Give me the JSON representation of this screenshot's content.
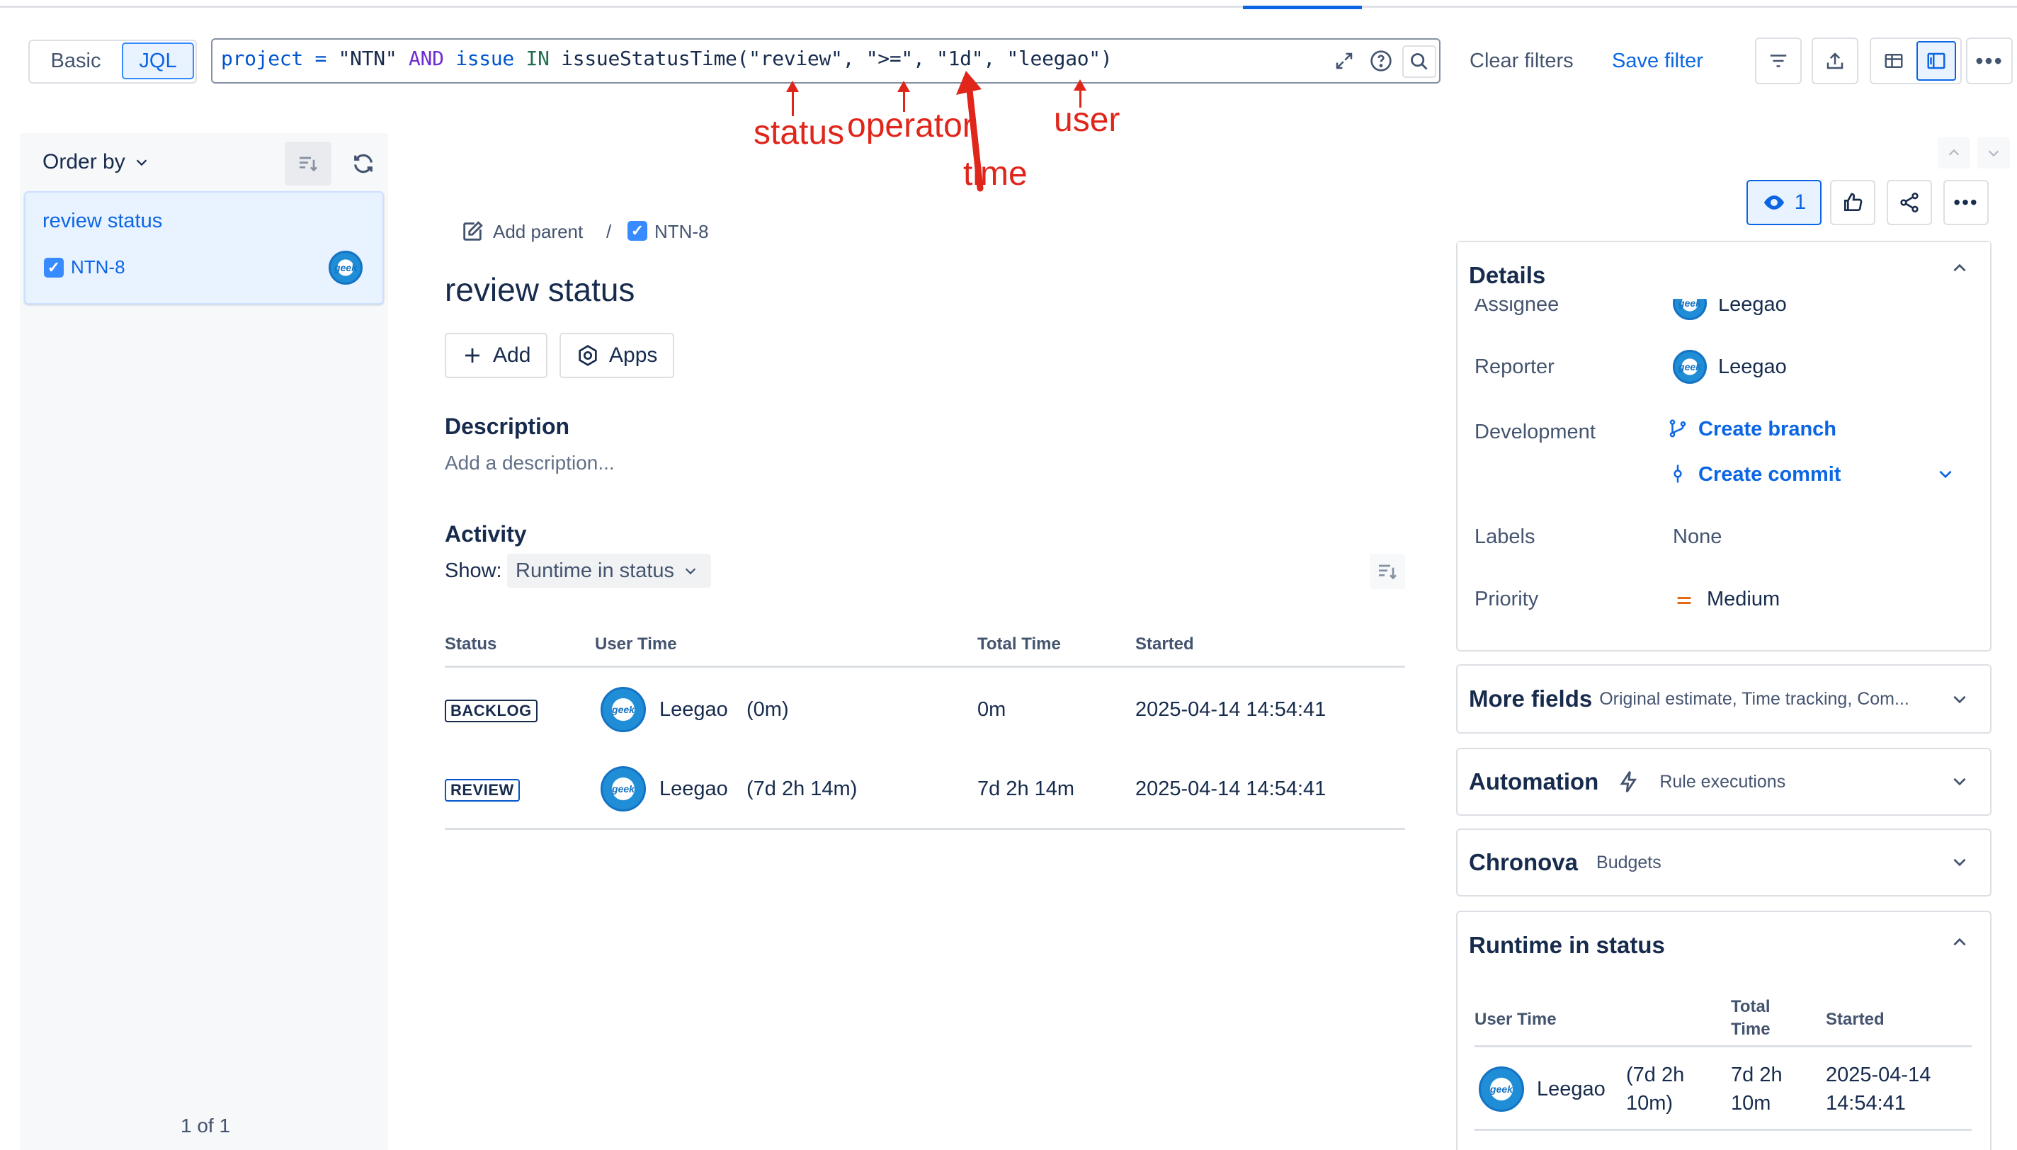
{
  "filter": {
    "basic_label": "Basic",
    "jql_label": "JQL",
    "jql_tokens": {
      "t1": "project",
      "t2": " = ",
      "t3": "\"NTN\"",
      "t4": " AND ",
      "t5": "issue",
      "t6": " IN ",
      "t7": "issueStatusTime(\"review\", \">=\", \"1d\", \"leegao\")"
    },
    "clear_filters": "Clear filters",
    "save_filter": "Save filter"
  },
  "annotations": {
    "status": "status",
    "operator": "operator",
    "time": "time",
    "user": "user"
  },
  "sidebar": {
    "order_by": "Order by",
    "card_title": "review status",
    "card_key": "NTN-8",
    "count": "1 of 1"
  },
  "issue": {
    "add_parent": "Add parent",
    "separator": "/",
    "key": "NTN-8",
    "title": "review status",
    "add_button": "Add",
    "apps_button": "Apps",
    "description_heading": "Description",
    "description_placeholder": "Add a description...",
    "activity_heading": "Activity",
    "show_label": "Show:",
    "show_value": "Runtime in status",
    "table": {
      "headers": [
        "Status",
        "User Time",
        "Total Time",
        "Started"
      ],
      "rows": [
        {
          "status": "BACKLOG",
          "user": "Leegao",
          "user_time": "(0m)",
          "total": "0m",
          "started": "2025-04-14 14:54:41"
        },
        {
          "status": "REVIEW",
          "user": "Leegao",
          "user_time": "(7d 2h 14m)",
          "total": "7d 2h 14m",
          "started": "2025-04-14 14:54:41"
        }
      ]
    }
  },
  "right": {
    "watch_count": "1",
    "details": {
      "heading": "Details",
      "assignee_label": "Assignee",
      "assignee_value": "Leegao",
      "reporter_label": "Reporter",
      "reporter_value": "Leegao",
      "development_label": "Development",
      "create_branch": "Create branch",
      "create_commit": "Create commit",
      "labels_label": "Labels",
      "labels_value": "None",
      "priority_label": "Priority",
      "priority_value": "Medium"
    },
    "more_fields": {
      "title": "More fields",
      "sub": "Original estimate, Time tracking, Com..."
    },
    "automation": {
      "title": "Automation",
      "sub": "Rule executions"
    },
    "chronova": {
      "title": "Chronova",
      "sub": "Budgets"
    },
    "runtime": {
      "title": "Runtime in status",
      "h_user_time": "User Time",
      "h_total_1": "Total",
      "h_total_2": "Time",
      "h_started": "Started",
      "user": "Leegao",
      "user_time_1": "(7d 2h",
      "user_time_2": "10m)",
      "total_1": "7d 2h",
      "total_2": "10m",
      "started_1": "2025-04-14",
      "started_2": "14:54:41"
    }
  },
  "colors": {
    "accent": "#0c66e4",
    "annotation": "#e0251b",
    "priority_medium": "#e56910"
  }
}
